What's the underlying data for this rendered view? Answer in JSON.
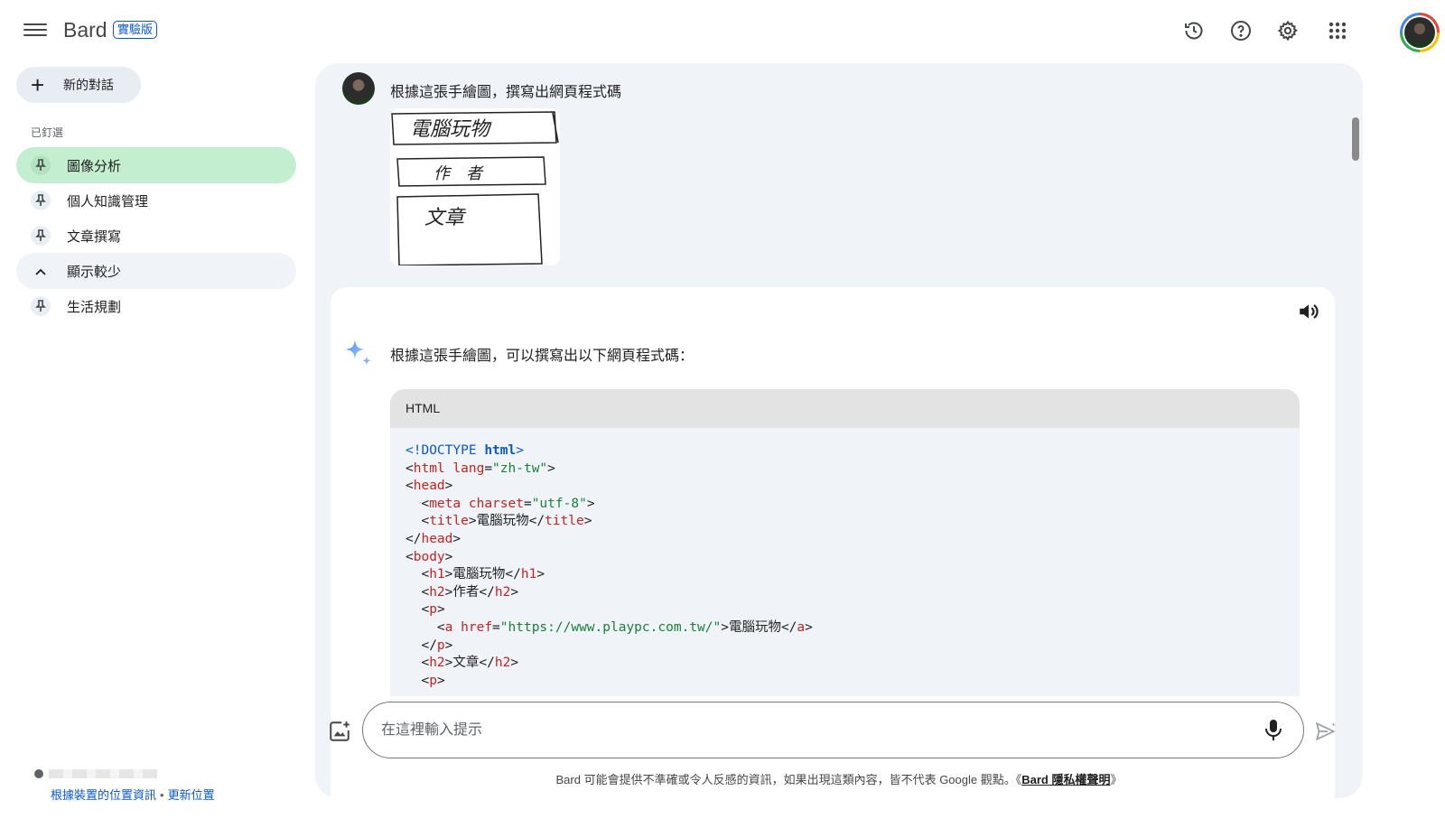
{
  "header": {
    "brand": "Bard",
    "badge": "實驗版",
    "icons": [
      "menu-icon",
      "history-icon",
      "help-icon",
      "settings-icon",
      "apps-icon",
      "account-avatar"
    ]
  },
  "sidebar": {
    "new_chat_label": "新的對話",
    "pinned_label": "已釘選",
    "items": [
      {
        "label": "圖像分析",
        "active": true
      },
      {
        "label": "個人知識管理",
        "active": false
      },
      {
        "label": "文章撰寫",
        "active": false
      }
    ],
    "show_less_label": "顯示較少",
    "extra_items": [
      {
        "label": "生活規劃"
      }
    ],
    "location": {
      "link1": "根據裝置的位置資訊",
      "separator": "•",
      "link2": "更新位置"
    }
  },
  "conversation": {
    "user_message": "根據這張手繪圖，撰寫出網頁程式碼",
    "sketch_text": [
      "電腦玩物",
      "作　者",
      "文章"
    ],
    "response_intro": "根據這張手繪圖，可以撰寫出以下網頁程式碼：",
    "code_language": "HTML",
    "code_lines": [
      [
        {
          "t": "kw",
          "v": "<!DOCTYPE "
        },
        {
          "t": "kwb",
          "v": "html"
        },
        {
          "t": "kw",
          "v": ">"
        }
      ],
      [
        {
          "t": "p",
          "v": "<"
        },
        {
          "t": "tag",
          "v": "html"
        },
        {
          "t": "p",
          "v": " "
        },
        {
          "t": "attr",
          "v": "lang"
        },
        {
          "t": "p",
          "v": "="
        },
        {
          "t": "str",
          "v": "\"zh-tw\""
        },
        {
          "t": "p",
          "v": ">"
        }
      ],
      [
        {
          "t": "p",
          "v": "<"
        },
        {
          "t": "tag",
          "v": "head"
        },
        {
          "t": "p",
          "v": ">"
        }
      ],
      [
        {
          "t": "p",
          "v": "  <"
        },
        {
          "t": "tag",
          "v": "meta"
        },
        {
          "t": "p",
          "v": " "
        },
        {
          "t": "attr",
          "v": "charset"
        },
        {
          "t": "p",
          "v": "="
        },
        {
          "t": "str",
          "v": "\"utf-8\""
        },
        {
          "t": "p",
          "v": ">"
        }
      ],
      [
        {
          "t": "p",
          "v": "  <"
        },
        {
          "t": "tag",
          "v": "title"
        },
        {
          "t": "p",
          "v": ">電腦玩物</"
        },
        {
          "t": "tag",
          "v": "title"
        },
        {
          "t": "p",
          "v": ">"
        }
      ],
      [
        {
          "t": "p",
          "v": "</"
        },
        {
          "t": "tag",
          "v": "head"
        },
        {
          "t": "p",
          "v": ">"
        }
      ],
      [
        {
          "t": "p",
          "v": "<"
        },
        {
          "t": "tag",
          "v": "body"
        },
        {
          "t": "p",
          "v": ">"
        }
      ],
      [
        {
          "t": "p",
          "v": "  <"
        },
        {
          "t": "tag",
          "v": "h1"
        },
        {
          "t": "p",
          "v": ">電腦玩物</"
        },
        {
          "t": "tag",
          "v": "h1"
        },
        {
          "t": "p",
          "v": ">"
        }
      ],
      [
        {
          "t": "p",
          "v": "  <"
        },
        {
          "t": "tag",
          "v": "h2"
        },
        {
          "t": "p",
          "v": ">作者</"
        },
        {
          "t": "tag",
          "v": "h2"
        },
        {
          "t": "p",
          "v": ">"
        }
      ],
      [
        {
          "t": "p",
          "v": "  <"
        },
        {
          "t": "tag",
          "v": "p"
        },
        {
          "t": "p",
          "v": ">"
        }
      ],
      [
        {
          "t": "p",
          "v": "    <"
        },
        {
          "t": "tag",
          "v": "a"
        },
        {
          "t": "p",
          "v": " "
        },
        {
          "t": "attr",
          "v": "href"
        },
        {
          "t": "p",
          "v": "="
        },
        {
          "t": "str",
          "v": "\"https://www.playpc.com.tw/\""
        },
        {
          "t": "p",
          "v": ">電腦玩物</"
        },
        {
          "t": "tag",
          "v": "a"
        },
        {
          "t": "p",
          "v": ">"
        }
      ],
      [
        {
          "t": "p",
          "v": "  </"
        },
        {
          "t": "tag",
          "v": "p"
        },
        {
          "t": "p",
          "v": ">"
        }
      ],
      [
        {
          "t": "p",
          "v": "  <"
        },
        {
          "t": "tag",
          "v": "h2"
        },
        {
          "t": "p",
          "v": ">文章</"
        },
        {
          "t": "tag",
          "v": "h2"
        },
        {
          "t": "p",
          "v": ">"
        }
      ],
      [
        {
          "t": "p",
          "v": "  <"
        },
        {
          "t": "tag",
          "v": "p"
        },
        {
          "t": "p",
          "v": ">"
        }
      ]
    ]
  },
  "input": {
    "placeholder": "在這裡輸入提示"
  },
  "footer": {
    "disclaimer": "Bard 可能會提供不準確或令人反感的資訊，如果出現這類內容，皆不代表 Google 觀點。《",
    "privacy_link": "Bard 隱私權聲明",
    "disclaimer_end": "》"
  },
  "colors": {
    "accent": "#0b57d0",
    "active_item": "#c4eed0",
    "panel_bg": "#f0f4f9"
  }
}
